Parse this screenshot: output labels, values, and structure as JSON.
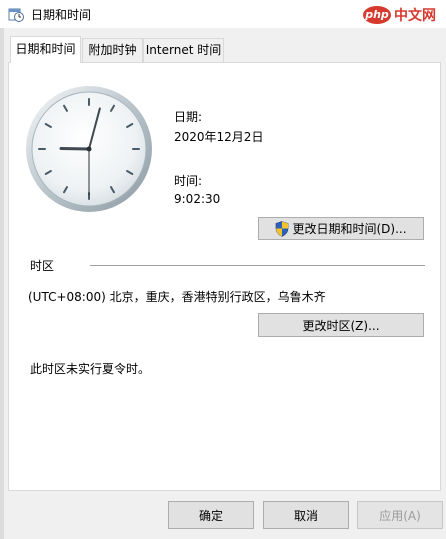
{
  "window": {
    "title": "日期和时间",
    "watermark": {
      "badge": "php",
      "text": "中文网"
    }
  },
  "tabs": [
    {
      "label": "日期和时间",
      "selected": true
    },
    {
      "label": "附加时钟",
      "selected": false
    },
    {
      "label": "Internet 时间",
      "selected": false
    }
  ],
  "datetime": {
    "date_label": "日期:",
    "date_value": "2020年12月2日",
    "time_label": "时间:",
    "time_value": "9:02:30",
    "change_button": "更改日期和时间(D)..."
  },
  "clock": {
    "hour": 9,
    "minute": 2,
    "second": 30
  },
  "timezone": {
    "heading": "时区",
    "value": "(UTC+08:00) 北京，重庆，香港特别行政区，乌鲁木齐",
    "change_button": "更改时区(Z)...",
    "dst_note": "此时区未实行夏令时。"
  },
  "footer": {
    "ok": "确定",
    "cancel": "取消",
    "apply": "应用(A)"
  },
  "colors": {
    "shield_blue": "#2c63b7",
    "shield_yellow": "#f2c22f",
    "watermark_red": "#d63a2f"
  }
}
